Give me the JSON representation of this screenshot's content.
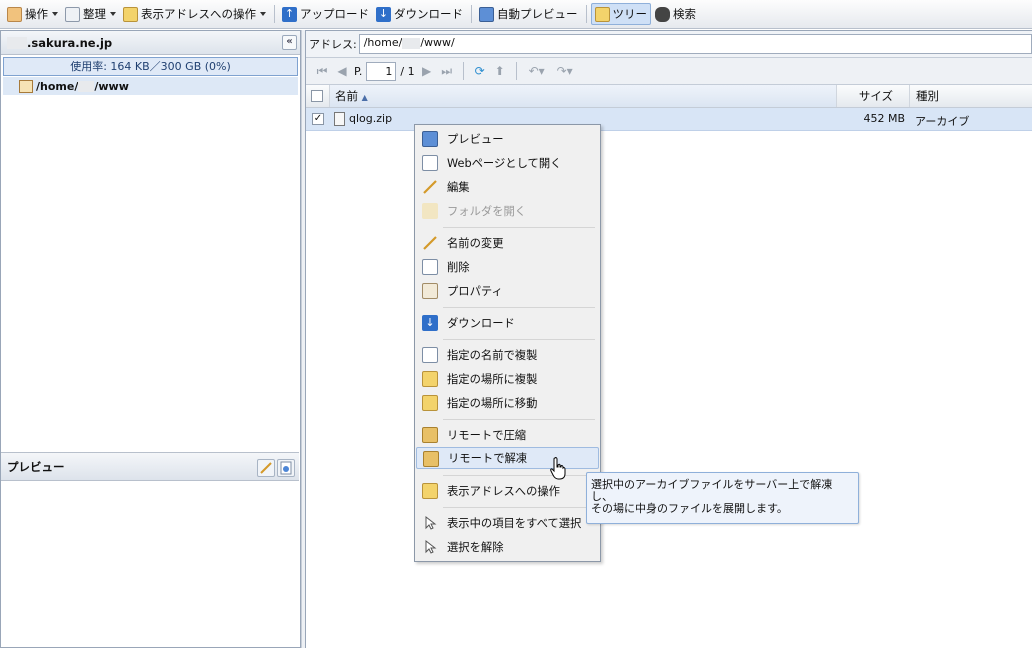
{
  "toolbar": {
    "operate_label": "操作",
    "organize_label": "整理",
    "address_ops_label": "表示アドレスへの操作",
    "upload_label": "アップロード",
    "download_label": "ダウンロード",
    "autopreview_label": "自動プレビュー",
    "tree_label": "ツリー",
    "search_label": "検索"
  },
  "left": {
    "domain": ".sakura.ne.jp",
    "usage": "使用率: 164 KB／300 GB (0%)",
    "tree_home": "/home/",
    "tree_www": "/www",
    "preview_title": "プレビュー"
  },
  "address": {
    "label": "アドレス:",
    "value_home": "/home/",
    "value_www": "/www",
    "value_slash": "/"
  },
  "nav": {
    "page_label": "P.",
    "page_value": "1",
    "page_total": "/ 1"
  },
  "columns": {
    "name": "名前",
    "size": "サイズ",
    "type": "種別"
  },
  "files": [
    {
      "name": "qlog.zip",
      "size": "452 MB",
      "type": "アーカイブ"
    }
  ],
  "menu": {
    "preview": "プレビュー",
    "open_web": "Webページとして開く",
    "edit": "編集",
    "open_folder": "フォルダを開く",
    "rename": "名前の変更",
    "delete": "削除",
    "properties": "プロパティ",
    "download": "ダウンロード",
    "copy_named": "指定の名前で複製",
    "copy_to": "指定の場所に複製",
    "move_to": "指定の場所に移動",
    "compress_remote": "リモートで圧縮",
    "extract_remote": "リモートで解凍",
    "address_ops": "表示アドレスへの操作",
    "select_all": "表示中の項目をすべて選択",
    "deselect": "選択を解除"
  },
  "tooltip": {
    "line1": "選択中のアーカイブファイルをサーバー上で解凍",
    "line2": "し、",
    "line3": "その場に中身のファイルを展開します。"
  },
  "icons": {
    "operate": "hand-icon",
    "organize": "organize-icon",
    "address_ops": "pencil-folder-icon",
    "upload": "upload-arrow-icon",
    "download": "download-arrow-icon",
    "autopreview": "monitor-icon",
    "tree": "tree-icon",
    "search": "binoculars-icon"
  },
  "colors": {
    "accent": "#2f6fc9",
    "selection": "#d8e5f6",
    "highlight_border": "#9fbbe0"
  }
}
